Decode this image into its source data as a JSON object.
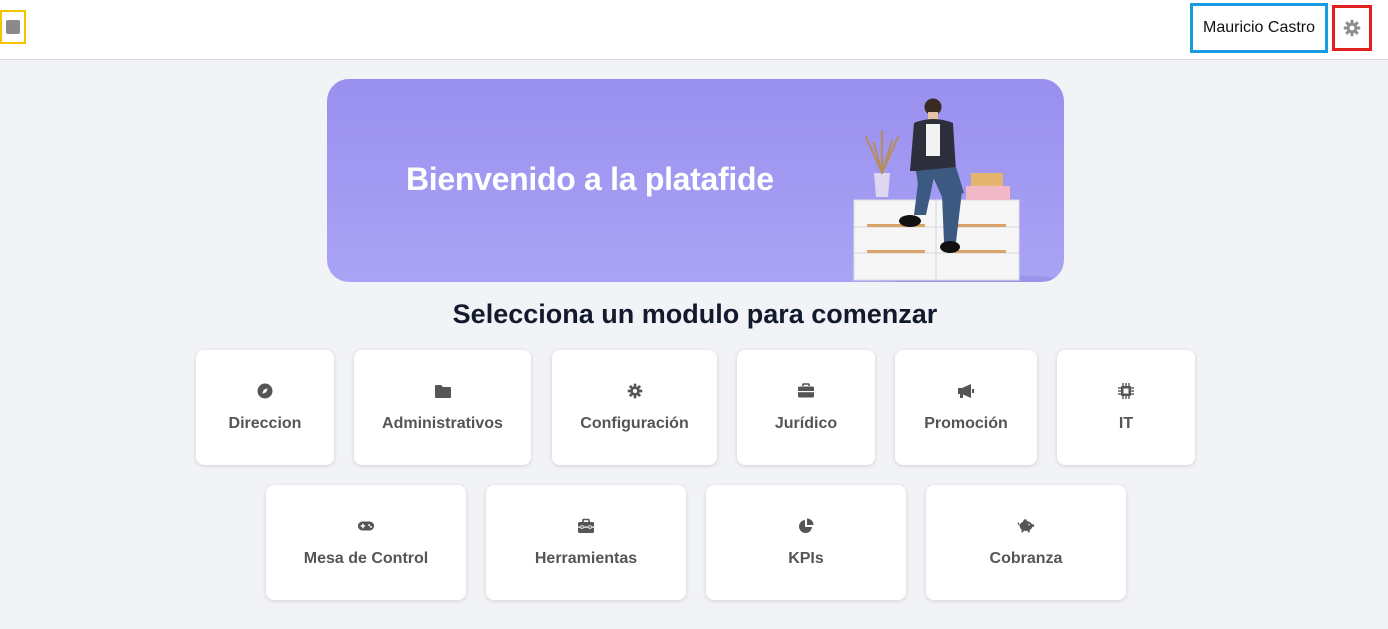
{
  "header": {
    "user_name": "Mauricio Castro",
    "icons": {
      "logo": "app-logo-icon",
      "settings": "gear-icon"
    }
  },
  "banner": {
    "title": "Bienvenido a la platafide"
  },
  "main": {
    "section_title": "Selecciona un modulo para comenzar",
    "modules_row1": [
      {
        "label": "Direccion",
        "icon": "compass-icon"
      },
      {
        "label": "Administrativos",
        "icon": "folder-icon"
      },
      {
        "label": "Configuración",
        "icon": "gear-icon"
      },
      {
        "label": "Jurídico",
        "icon": "briefcase-icon"
      },
      {
        "label": "Promoción",
        "icon": "megaphone-icon"
      },
      {
        "label": "IT",
        "icon": "microchip-icon"
      }
    ],
    "modules_row2": [
      {
        "label": "Mesa de Control",
        "icon": "gamepad-icon"
      },
      {
        "label": "Herramientas",
        "icon": "toolbox-icon"
      },
      {
        "label": "KPIs",
        "icon": "pie-chart-icon"
      },
      {
        "label": "Cobranza",
        "icon": "piggy-bank-icon"
      }
    ]
  },
  "colors": {
    "background": "#f2f3f7",
    "banner": "#a29bf2",
    "card_text": "#555555",
    "highlight_yellow": "#f5c400",
    "highlight_blue": "#1a9be0",
    "highlight_red": "#e02020"
  }
}
